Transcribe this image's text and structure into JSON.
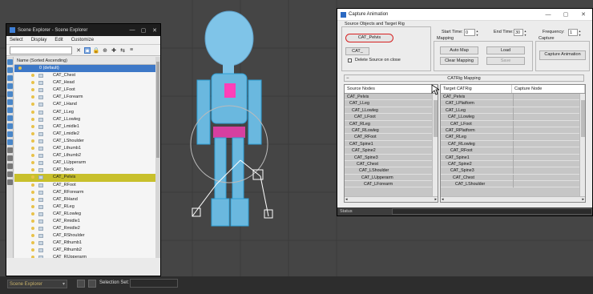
{
  "scene_explorer": {
    "title": "Scene Explorer - Scene Explorer",
    "menu": [
      "Select",
      "Display",
      "Edit",
      "Customize"
    ],
    "column_header": "Name (Sorted Ascending)",
    "root_item": "0 (default)",
    "items": [
      "CAT_Chest",
      "CAT_Head",
      "CAT_LFoot",
      "CAT_LForearm",
      "CAT_LHand",
      "CAT_LLeg",
      "CAT_LLowleg",
      "CAT_Lmidle1",
      "CAT_Lmidle2",
      "CAT_LShoulder",
      "CAT_Lthumb1",
      "CAT_Lthumb2",
      "CAT_LUpperarm",
      "CAT_Neck",
      "CAT_Pelvis",
      "CAT_RFoot",
      "CAT_RForearm",
      "CAT_RHand",
      "CAT_RLeg",
      "CAT_RLowleg",
      "CAT_Rmidle1",
      "CAT_Rmidle2",
      "CAT_RShoulder",
      "CAT_Rthumb1",
      "CAT_Rthumb2",
      "CAT_RUpperarm",
      "CAT_Spine1"
    ],
    "selected_item": "CAT_Pelvis"
  },
  "bottom_bar": {
    "explorer_combo": "Scene Explorer",
    "selection_set_label": "Selection Set:"
  },
  "capture": {
    "title": "Capture Animation",
    "source_group_title": "Source Objects and Target Rig",
    "source_button": "CAT_Pelvis",
    "cat_button": "CAT_",
    "delete_source_label": "Delete Source on close",
    "start_time_label": "Start Time:",
    "start_time_value": "0",
    "end_time_label": "End Time:",
    "end_time_value": "30",
    "frequency_label": "Frequency:",
    "frequency_value": "1",
    "mapping_group_title": "Mapping",
    "auto_map": "Auto Map",
    "load": "Load",
    "clear_mapping": "Clear Mapping",
    "save": "Save",
    "capture_group_title": "Capture",
    "capture_button": "Capture Animation",
    "section_bar": "CATRig Mapping",
    "source_header": "Source Nodes",
    "source_nodes": [
      "CAT_Pelvis",
      "CAT_LLeg",
      "CAT_LLowleg",
      "CAT_LFoot",
      "CAT_RLeg",
      "CAT_RLowleg",
      "CAT_RFoot",
      "CAT_Spine1",
      "CAT_Spine2",
      "CAT_Spine3",
      "CAT_Chest",
      "CAT_LShoulder",
      "CAT_LUpperarm",
      "CAT_LForearm"
    ],
    "target_header": "Target CATRig",
    "capture_header": "Capture Node",
    "target_nodes": [
      "CAT_Pelvis",
      "CAT_LPlatform",
      "CAT_LLeg",
      "CAT_LLowleg",
      "CAT_LFoot",
      "CAT_RPlatform",
      "CAT_RLeg",
      "CAT_RLowleg",
      "CAT_RFoot",
      "CAT_Spine1",
      "CAT_Spine2",
      "CAT_Spine3",
      "CAT_Chest",
      "CAT_LShoulder"
    ],
    "status_label": "Status"
  }
}
